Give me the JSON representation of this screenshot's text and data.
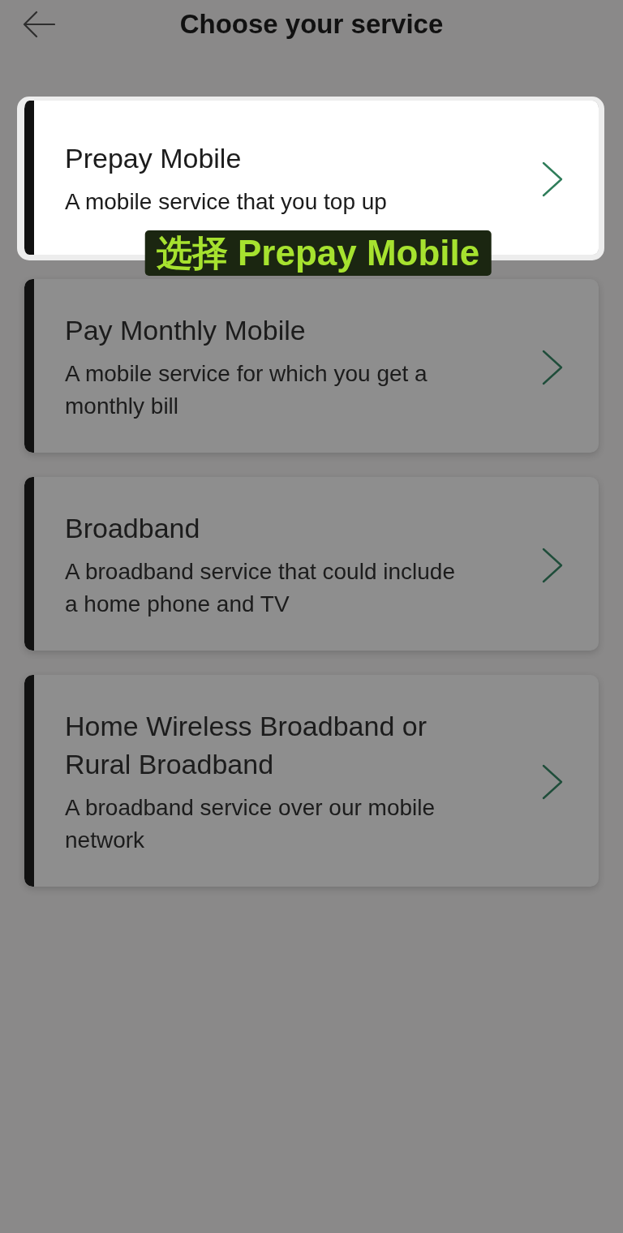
{
  "header": {
    "title": "Choose your service"
  },
  "services": [
    {
      "title": "Prepay Mobile",
      "description": "A mobile service that you top up",
      "selected": true
    },
    {
      "title": "Pay Monthly Mobile",
      "description": "A mobile service for which you get a monthly bill",
      "selected": false
    },
    {
      "title": "Broadband",
      "description": "A broadband service that could include a home phone and TV",
      "selected": false
    },
    {
      "title": "Home Wireless Broadband or Rural Broadband",
      "description": "A broadband service over our mobile network",
      "selected": false
    }
  ],
  "callout": {
    "text": "选择 Prepay Mobile"
  }
}
